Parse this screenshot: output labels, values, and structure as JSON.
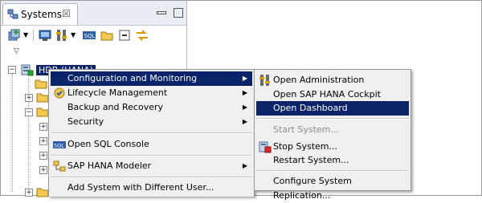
{
  "panel": {
    "tab_label": "Systems",
    "tab_close": "☒"
  },
  "toolbar": {
    "icons": [
      "add-system-icon",
      "dropdown-arrow-icon",
      "monitor-icon",
      "administration-icon",
      "dropdown-arrow-icon",
      "sql-icon",
      "folder-icon",
      "collapse-icon",
      "link-icon"
    ]
  },
  "tree": {
    "selected_node": "HDB (HANA)"
  },
  "context_menu": {
    "items": [
      {
        "label": "Configuration and Monitoring",
        "icon": "",
        "submenu": true,
        "highlighted": true
      },
      {
        "label": "Lifecycle Management",
        "icon": "lifecycle-icon",
        "submenu": true
      },
      {
        "label": "Backup and Recovery",
        "icon": "",
        "submenu": true
      },
      {
        "label": "Security",
        "icon": "",
        "submenu": true
      },
      {
        "label": "Open SQL Console",
        "icon": "sql-console-icon",
        "submenu": false
      },
      {
        "label": "SAP HANA Modeler",
        "icon": "modeler-icon",
        "submenu": true
      },
      {
        "label": "Add System with Different User...",
        "icon": "",
        "submenu": false
      }
    ]
  },
  "submenu": {
    "items": [
      {
        "label": "Open Administration",
        "icon": "administration-icon"
      },
      {
        "label": "Open SAP HANA Cockpit",
        "icon": ""
      },
      {
        "label": "Open Dashboard",
        "icon": "",
        "highlighted": true
      },
      {
        "label": "Start System...",
        "icon": "",
        "disabled": true
      },
      {
        "label": "Stop System...",
        "icon": "stop-system-icon"
      },
      {
        "label": "Restart System...",
        "icon": ""
      },
      {
        "label": "Configure System Replication...",
        "icon": ""
      }
    ]
  },
  "colors": {
    "selection": "#0a246a",
    "menu_bg": "#f0f0f0",
    "disabled_text": "#8d8d8d"
  }
}
